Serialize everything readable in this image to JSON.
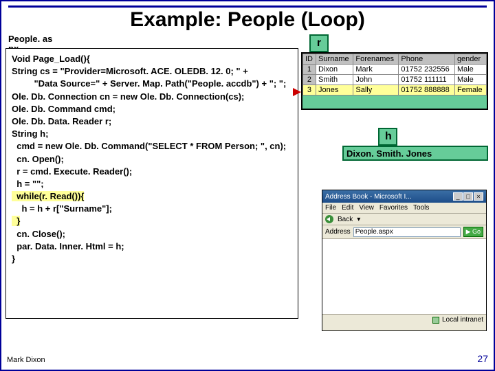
{
  "title": "Example: People (Loop)",
  "filelabel": "People. as px",
  "code_lines": [
    "Void Page_Load(){",
    "String cs = \"Provider=Microsoft. ACE. OLEDB. 12. 0; \" +",
    "         \"Data Source=\" + Server. Map. Path(\"People. accdb\") + \"; \";",
    "Ole. Db. Connection cn = new Ole. Db. Connection(cs);",
    "Ole. Db. Command cmd;",
    "Ole. Db. Data. Reader r;",
    "String h;",
    "  cmd = new Ole. Db. Command(\"SELECT * FROM Person; \", cn);",
    "  cn. Open();",
    "  r = cmd. Execute. Reader();",
    "  h = \"\";",
    "  while(r. Read()){",
    "    h = h + r[\"Surname\"];",
    "  }",
    "  cn. Close();",
    "  par. Data. Inner. Html = h;",
    "}"
  ],
  "var_r": "r",
  "var_h": "h",
  "table": {
    "headers": [
      "ID",
      "Surname",
      "Forenames",
      "Phone",
      "gender"
    ],
    "rows": [
      [
        "1",
        "Dixon",
        "Mark",
        "01752 232556",
        "Male"
      ],
      [
        "2",
        "Smith",
        "John",
        "01752 111111",
        "Male"
      ],
      [
        "3",
        "Jones",
        "Sally",
        "01752 888888",
        "Female"
      ]
    ],
    "cursor_row": 2
  },
  "result_text": "Dixon. Smith. Jones",
  "browser": {
    "title": "Address Book - Microsoft I...",
    "menus": [
      "File",
      "Edit",
      "View",
      "Favorites",
      "Tools"
    ],
    "back": "Back",
    "address_label": "Address",
    "url": "People.aspx",
    "go": "Go",
    "status": "Local intranet"
  },
  "footer": {
    "author": "Mark Dixon",
    "page": "27"
  }
}
